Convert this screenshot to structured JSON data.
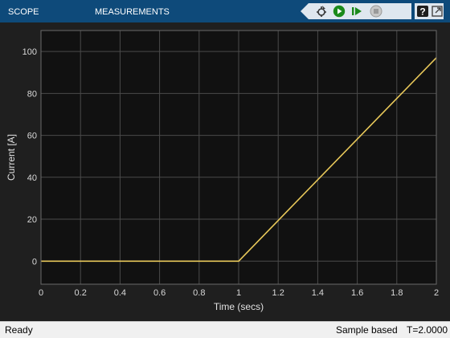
{
  "toolbar": {
    "tabs": [
      "SCOPE",
      "MEASUREMENTS"
    ],
    "tools": [
      "cursor-settings-icon",
      "run-icon",
      "step-forward-icon",
      "stop-icon"
    ],
    "help_icon": "help-icon",
    "options_icon": "undock-icon"
  },
  "status": {
    "ready": "Ready",
    "mode": "Sample based",
    "time": "T=2.0000"
  },
  "colors": {
    "toolbar_bg": "#0e4a7a",
    "plot_bg": "#111111",
    "line": "#e8c85a",
    "grid": "#4a4a4a"
  },
  "chart_data": {
    "type": "line",
    "xlabel": "Time (secs)",
    "ylabel": "Current [A]",
    "xlim": [
      0,
      2
    ],
    "ylim": [
      -11,
      110
    ],
    "xticks": [
      0,
      0.2,
      0.4,
      0.6,
      0.8,
      1,
      1.2,
      1.4,
      1.6,
      1.8,
      2
    ],
    "xtick_labels": [
      "0",
      "0.2",
      "0.4",
      "0.6",
      "0.8",
      "1",
      "1.2",
      "1.4",
      "1.6",
      "1.8",
      "2"
    ],
    "yticks": [
      0,
      20,
      40,
      60,
      80,
      100
    ],
    "ytick_labels": [
      "0",
      "20",
      "40",
      "60",
      "80",
      "100"
    ],
    "grid": true,
    "series": [
      {
        "x": [
          0,
          1,
          2
        ],
        "y": [
          0,
          0,
          97
        ]
      }
    ]
  }
}
